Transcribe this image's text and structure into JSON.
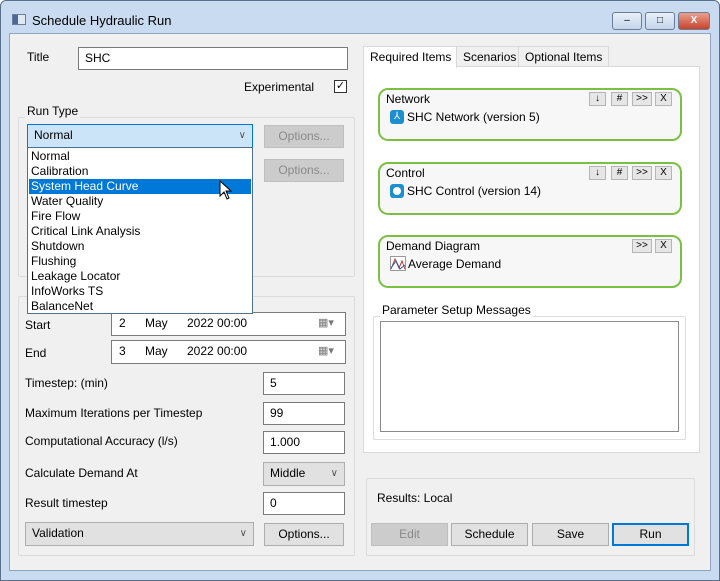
{
  "window": {
    "title": "Schedule Hydraulic Run",
    "minimize": "–",
    "maximize": "□",
    "close": "X"
  },
  "form": {
    "title_label": "Title",
    "title_value": "SHC",
    "experimental_label": "Experimental",
    "experimental_checked": true,
    "run_type_label": "Run Type",
    "run_type_selected": "Normal",
    "options_label": "Options...",
    "run_type_options": [
      "Normal",
      "Calibration",
      "System Head Curve",
      "Water Quality",
      "Fire Flow",
      "Critical Link Analysis",
      "Shutdown",
      "Flushing",
      "Leakage Locator",
      "InfoWorks TS",
      "BalanceNet"
    ],
    "highlighted_option": "System Head Curve",
    "start_label": "Start",
    "start": {
      "day": "2",
      "month": "May",
      "year_time": "2022  00:00"
    },
    "end_label": "End",
    "end": {
      "day": "3",
      "month": "May",
      "year_time": "2022  00:00"
    },
    "timestep_label": "Timestep: (min)",
    "timestep_value": "5",
    "max_iter_label": "Maximum Iterations per Timestep",
    "max_iter_value": "99",
    "accuracy_label": "Computational Accuracy (l/s)",
    "accuracy_value": "1.000",
    "demand_at_label": "Calculate Demand At",
    "demand_at_value": "Middle",
    "result_timestep_label": "Result timestep",
    "result_timestep_value": "0",
    "validation_value": "Validation",
    "validation_options_label": "Options..."
  },
  "tabs": [
    {
      "label": "Required Items"
    },
    {
      "label": "Scenarios"
    },
    {
      "label": "Optional Items"
    }
  ],
  "required": {
    "network": {
      "label": "Network",
      "item": "SHC Network (version 5)"
    },
    "control": {
      "label": "Control",
      "item": "SHC Control (version 14)"
    },
    "demand": {
      "label": "Demand Diagram",
      "item": "Average Demand"
    },
    "btn_down": "↓",
    "btn_hash": "#",
    "btn_more": ">>",
    "btn_x": "X"
  },
  "messages_label": "Parameter Setup Messages",
  "results_label": "Results: Local",
  "buttons": {
    "edit": "Edit",
    "schedule": "Schedule",
    "save": "Save",
    "run": "Run"
  },
  "colors": {
    "accent": "#0078d7",
    "item_border": "#7ac143"
  }
}
